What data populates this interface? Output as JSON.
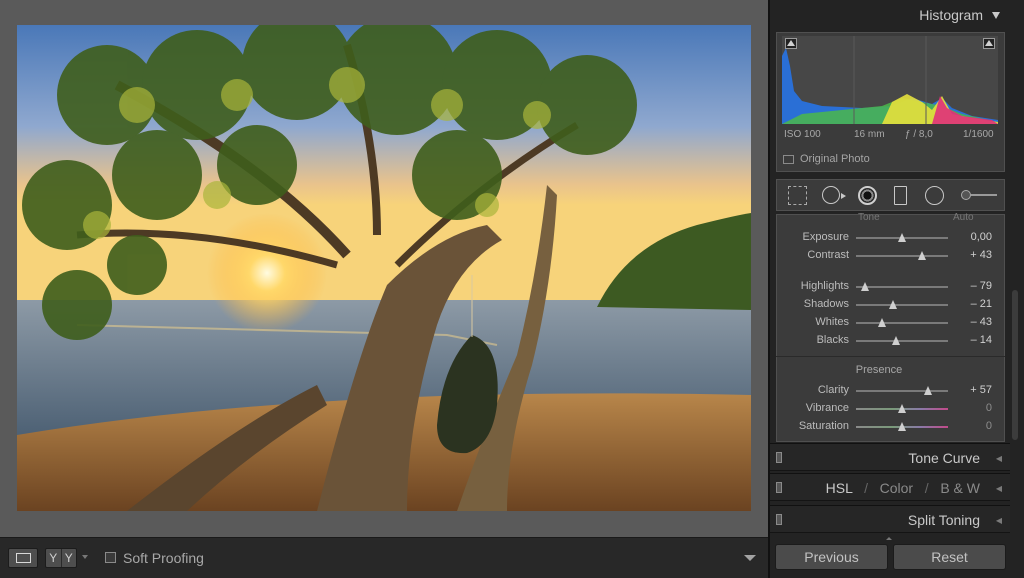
{
  "histogram": {
    "title": "Histogram",
    "exif": {
      "iso": "ISO 100",
      "focal": "16 mm",
      "aperture": "ƒ / 8,0",
      "shutter": "1/1600"
    },
    "original_photo_label": "Original Photo"
  },
  "basic": {
    "peek_labels": [
      "Tone",
      "Auto"
    ],
    "tone": [
      {
        "label": "Exposure",
        "value": "0,00",
        "level": 0.5
      },
      {
        "label": "Contrast",
        "value": "+ 43",
        "level": 0.72
      }
    ],
    "tone_detail": [
      {
        "label": "Highlights",
        "value": "– 79",
        "level": 0.1
      },
      {
        "label": "Shadows",
        "value": "– 21",
        "level": 0.4
      },
      {
        "label": "Whites",
        "value": "– 43",
        "level": 0.28
      },
      {
        "label": "Blacks",
        "value": "– 14",
        "level": 0.43
      }
    ],
    "presence_title": "Presence",
    "presence": [
      {
        "label": "Clarity",
        "value": "+ 57",
        "level": 0.78
      },
      {
        "label": "Vibrance",
        "value": "0",
        "level": 0.5
      },
      {
        "label": "Saturation",
        "value": "0",
        "level": 0.5
      }
    ]
  },
  "panels": {
    "tone_curve": "Tone Curve",
    "hsl": {
      "hsl": "HSL",
      "sep": "/",
      "color": "Color",
      "bw": "B & W"
    },
    "split_toning": "Split Toning"
  },
  "buttons": {
    "previous": "Previous",
    "reset": "Reset"
  },
  "toolbar": {
    "yy_left": "Y",
    "yy_right": "Y",
    "soft_proofing": "Soft Proofing"
  },
  "colors": {
    "panel_bg": "#3b3b3b",
    "canvas_bg": "#5a5a5a",
    "text": "#bcbcbc"
  }
}
